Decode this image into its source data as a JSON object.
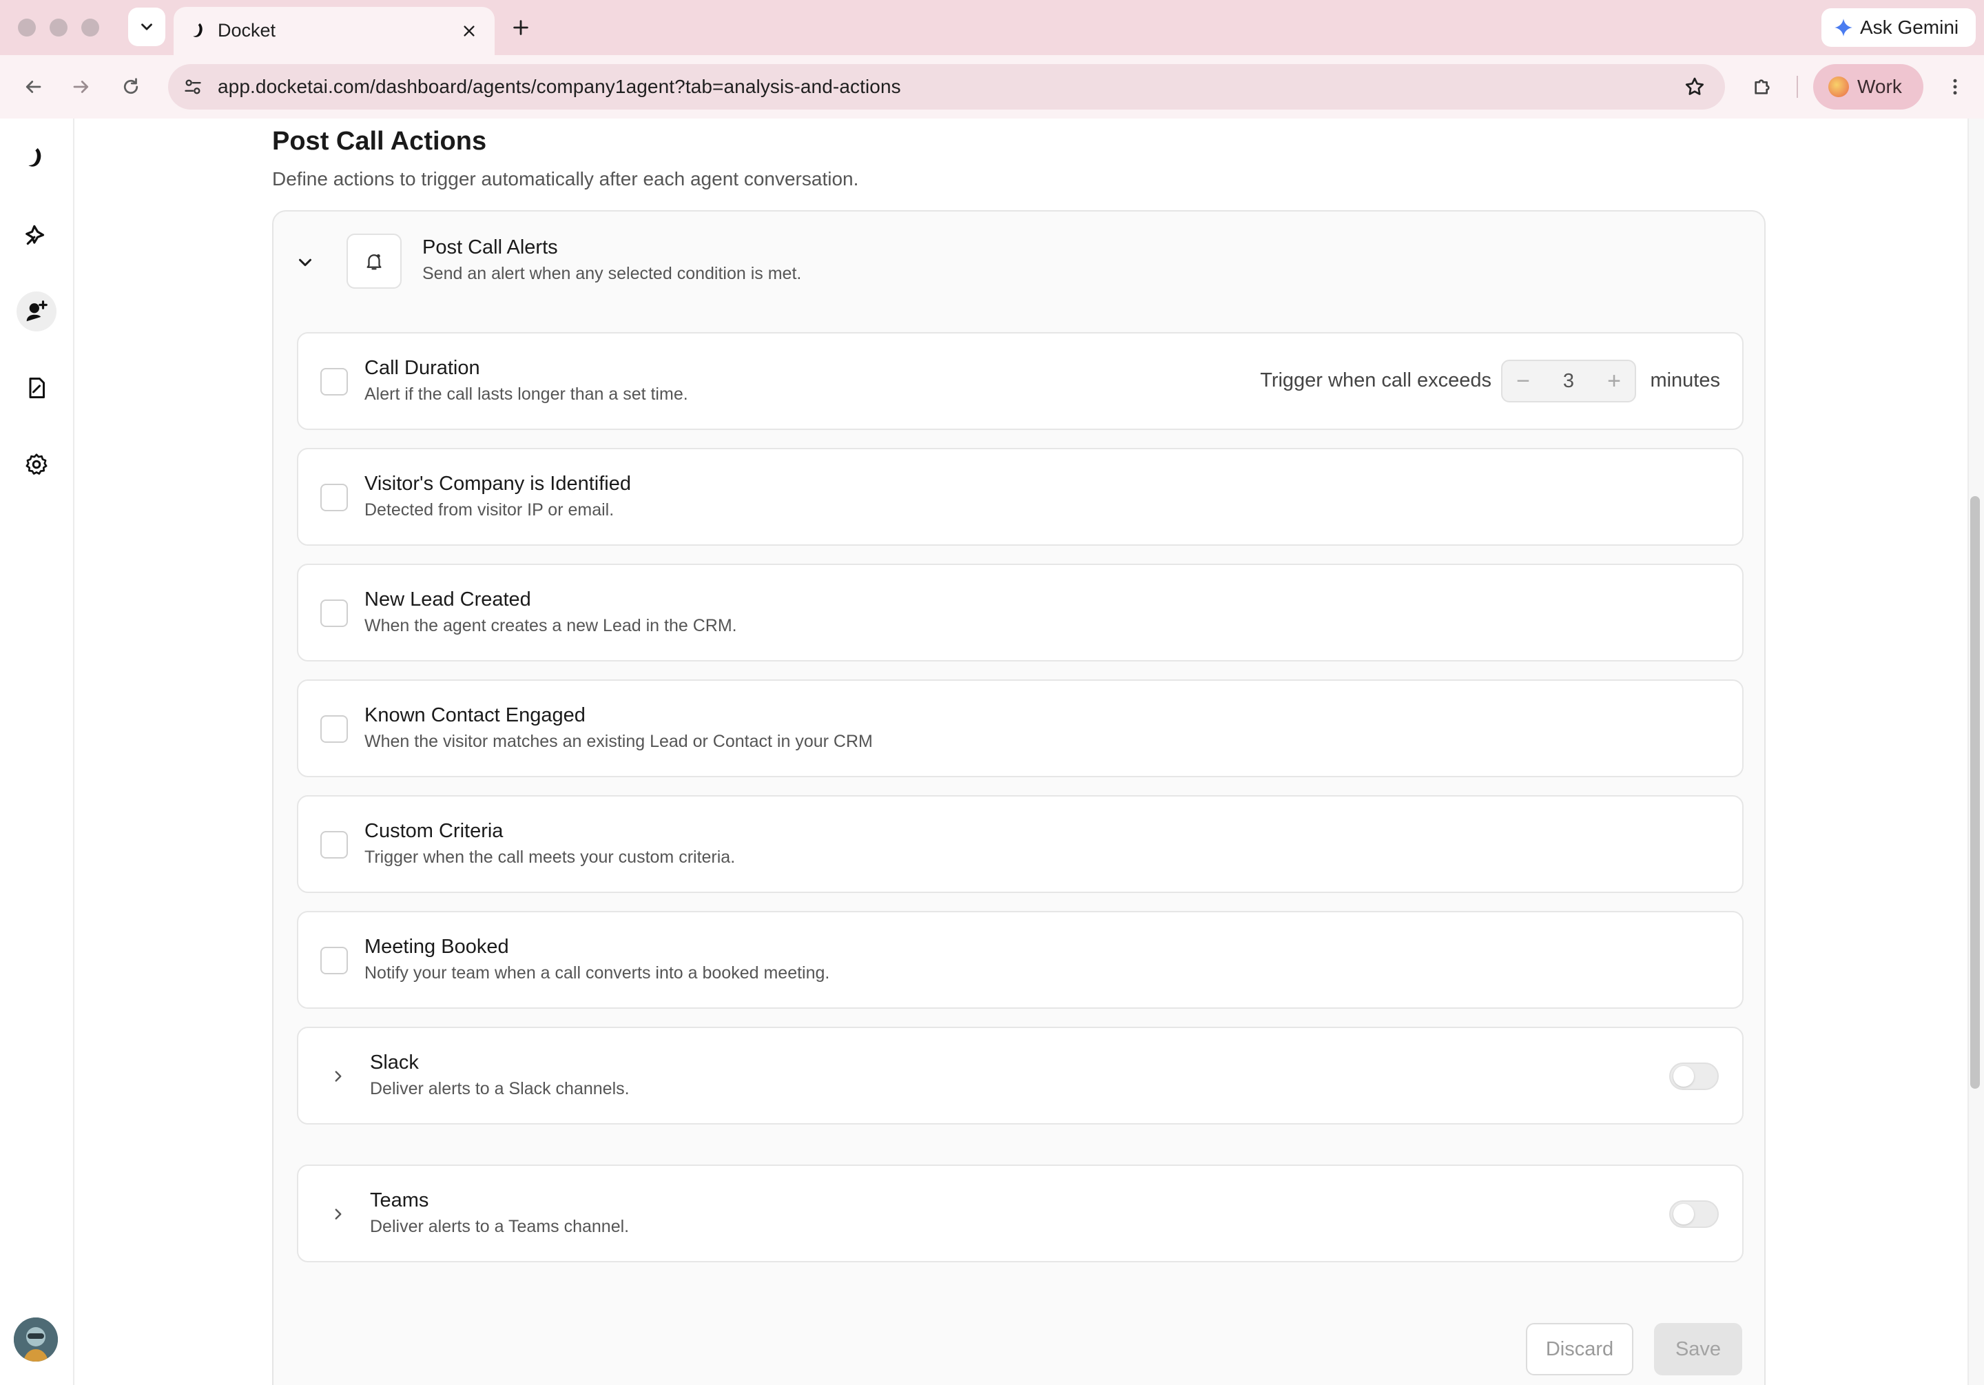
{
  "browser": {
    "tab_title": "Docket",
    "ask_gemini": "Ask Gemini",
    "url": "app.docketai.com/dashboard/agents/company1agent?tab=analysis-and-actions",
    "profile_label": "Work"
  },
  "sidebar": {
    "icons": [
      "docket-logo-icon",
      "agents-icon",
      "user-add-icon",
      "docs-icon",
      "gear-icon"
    ],
    "active_index": 2
  },
  "section": {
    "title": "Post Call Actions",
    "description": "Define actions to trigger automatically after each agent conversation."
  },
  "alerts_panel": {
    "title": "Post Call Alerts",
    "subtitle": "Send an alert when any selected condition is met.",
    "conditions": [
      {
        "title": "Call Duration",
        "subtitle": "Alert if the call lasts longer than a set time.",
        "checked": false
      },
      {
        "title": "Visitor's Company is Identified",
        "subtitle": "Detected from visitor IP or email.",
        "checked": false
      },
      {
        "title": "New Lead Created",
        "subtitle": "When the agent creates a new Lead in the CRM.",
        "checked": false
      },
      {
        "title": "Known Contact Engaged",
        "subtitle": "When the visitor matches an existing Lead or Contact in your CRM",
        "checked": false
      },
      {
        "title": "Custom Criteria",
        "subtitle": "Trigger when the call meets your custom criteria.",
        "checked": false
      },
      {
        "title": "Meeting Booked",
        "subtitle": "Notify your team when a call converts into a booked meeting.",
        "checked": false
      }
    ],
    "duration": {
      "label": "Trigger when call exceeds",
      "value": "3",
      "units": "minutes",
      "minus": "−",
      "plus": "+"
    },
    "integrations": [
      {
        "title": "Slack",
        "subtitle": "Deliver alerts to a Slack channels.",
        "enabled": false
      },
      {
        "title": "Teams",
        "subtitle": "Deliver alerts to a Teams channel.",
        "enabled": false
      }
    ]
  },
  "actions": {
    "discard": "Discard",
    "save": "Save"
  },
  "colors": {
    "chrome_bg": "#f3d9df",
    "toolbar_bg": "#fbf2f4",
    "profile_pill": "#efc5d0",
    "panel_bg": "#fafafa",
    "border": "#e6e6e6"
  }
}
